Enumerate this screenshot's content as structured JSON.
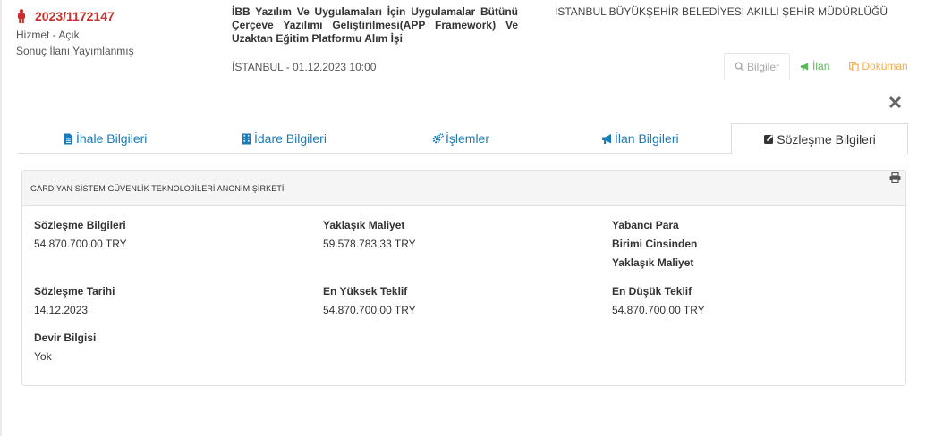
{
  "header": {
    "ikn": "2023/1172147",
    "type": "Hizmet - Açık",
    "status": "Sonuç İlanı Yayımlanmış",
    "title": "İBB Yazılım Ve Uygulamaları İçin Uygulamalar Bütünü Çerçeve Yazılımı Geliştirilmesi(APP Framework) Ve Uzaktan Eğitim Platformu Alım İşi",
    "location_date": "İSTANBUL - 01.12.2023 10:00",
    "authority": "İSTANBUL BÜYÜKŞEHİR BELEDİYESİ AKILLI ŞEHİR MÜDÜRLÜĞÜ"
  },
  "quick_tabs": [
    {
      "label": "Bilgiler",
      "icon": "search-icon"
    },
    {
      "label": "İlan",
      "icon": "bullhorn-icon"
    },
    {
      "label": "Doküman",
      "icon": "copy-icon"
    }
  ],
  "tabs": [
    {
      "label": "İhale Bilgileri",
      "icon": "file-text-icon"
    },
    {
      "label": "İdare Bilgileri",
      "icon": "building-icon"
    },
    {
      "label": "İşlemler",
      "icon": "cogs-icon"
    },
    {
      "label": "İlan Bilgileri",
      "icon": "bullhorn-icon"
    },
    {
      "label": "Sözleşme Bilgileri",
      "icon": "edit-icon"
    }
  ],
  "contract": {
    "company": "GARDİYAN SİSTEM GÜVENLİK TEKNOLOJİLERİ ANONİM ŞİRKETİ",
    "fields": [
      {
        "label": "Sözleşme Bilgileri",
        "value": "54.870.700,00 TRY"
      },
      {
        "label": "Yaklaşık Maliyet",
        "value": "59.578.783,33 TRY"
      },
      {
        "label_lines": [
          "Yabancı Para",
          "Birimi Cinsinden",
          "Yaklaşık Maliyet"
        ],
        "value": ""
      },
      {
        "label": "Sözleşme Tarihi",
        "value": "14.12.2023"
      },
      {
        "label": "En Yüksek Teklif",
        "value": "54.870.700,00 TRY"
      },
      {
        "label": "En Düşük Teklif",
        "value": "54.870.700,00 TRY"
      },
      {
        "label": "Devir Bilgisi",
        "value": "Yok"
      }
    ]
  },
  "colors": {
    "ikn": "#c9302c",
    "tab_link": "#1a7bb9",
    "ilan": "#5cb85c",
    "document": "#f0ad4e"
  }
}
